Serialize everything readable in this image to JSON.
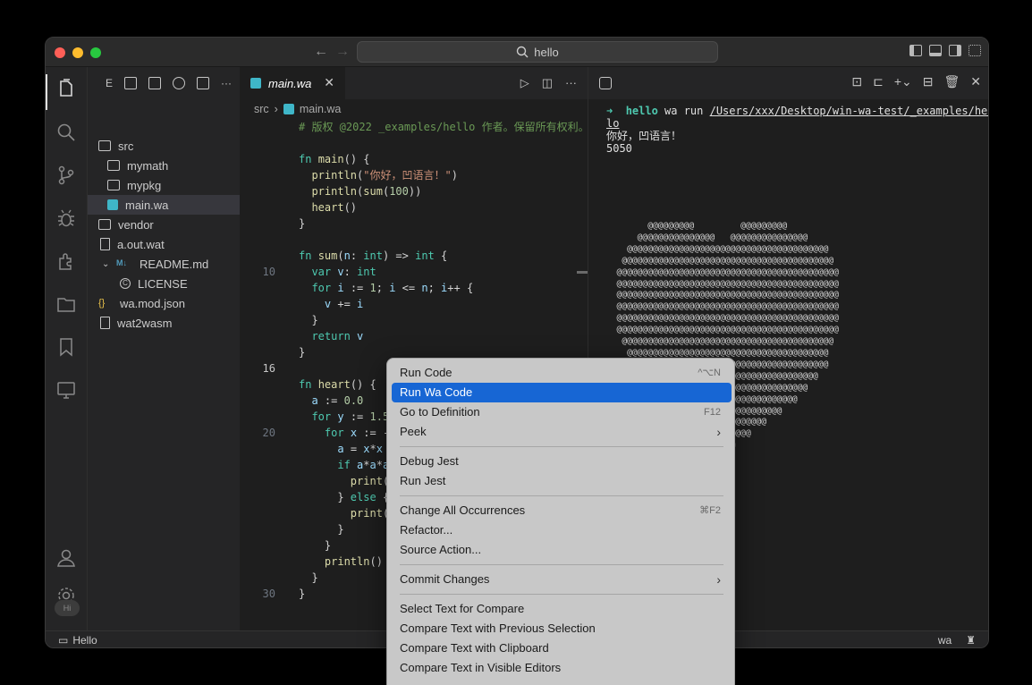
{
  "search": {
    "text": "hello"
  },
  "sidebar": {
    "header_label": "E",
    "items": [
      {
        "label": "src",
        "kind": "folder-open"
      },
      {
        "label": "mymath",
        "kind": "folder"
      },
      {
        "label": "mypkg",
        "kind": "folder"
      },
      {
        "label": "main.wa",
        "kind": "wa"
      },
      {
        "label": "vendor",
        "kind": "folder"
      },
      {
        "label": "a.out.wat",
        "kind": "file"
      },
      {
        "label": "README.md",
        "kind": "md"
      },
      {
        "label": "LICENSE",
        "kind": "license"
      },
      {
        "label": "wa.mod.json",
        "kind": "json"
      },
      {
        "label": "wat2wasm",
        "kind": "file"
      }
    ]
  },
  "editor": {
    "tab_label": "main.wa",
    "breadcrumb": {
      "folder": "src",
      "file": "main.wa"
    },
    "line_numbers": {
      "l10": "10",
      "l16": "16",
      "l20": "20",
      "l30": "30"
    },
    "lines": [
      "# 版权 @2022 _examples/hello 作者。保留所有权利。",
      "",
      "fn main() {",
      "  println(\"你好，凹语言！\")",
      "  println(sum(100))",
      "  heart()",
      "}",
      "",
      "fn sum(n: int) => int {",
      "  var v: int",
      "  for i := 1; i <= n; i++ {",
      "    v += i",
      "  }",
      "  return v",
      "}",
      "",
      "fn heart() {",
      "  a := 0.0",
      "  for y := 1.5",
      "    for x := -",
      "      a = x*x",
      "      if a*a*a",
      "        print(",
      "      } else {",
      "        print(",
      "      }",
      "    }",
      "    println()",
      "  }",
      "}"
    ]
  },
  "terminal": {
    "prompt_cmd": "hello",
    "prompt_rest": " wa run ",
    "path": "/Users/xxx/Desktop/win-wa-test/_examples/hel",
    "path_wrap": "lo",
    "output": [
      "你好，凹语言！",
      "5050"
    ],
    "heart": [
      "        @@@@@@@@@         @@@@@@@@@",
      "      @@@@@@@@@@@@@@@   @@@@@@@@@@@@@@@",
      "    @@@@@@@@@@@@@@@@@@@@@@@@@@@@@@@@@@@@@@@",
      "   @@@@@@@@@@@@@@@@@@@@@@@@@@@@@@@@@@@@@@@@@",
      "  @@@@@@@@@@@@@@@@@@@@@@@@@@@@@@@@@@@@@@@@@@@",
      "  @@@@@@@@@@@@@@@@@@@@@@@@@@@@@@@@@@@@@@@@@@@",
      "  @@@@@@@@@@@@@@@@@@@@@@@@@@@@@@@@@@@@@@@@@@@",
      "  @@@@@@@@@@@@@@@@@@@@@@@@@@@@@@@@@@@@@@@@@@@",
      "  @@@@@@@@@@@@@@@@@@@@@@@@@@@@@@@@@@@@@@@@@@@",
      "  @@@@@@@@@@@@@@@@@@@@@@@@@@@@@@@@@@@@@@@@@@@",
      "   @@@@@@@@@@@@@@@@@@@@@@@@@@@@@@@@@@@@@@@@@",
      "    @@@@@@@@@@@@@@@@@@@@@@@@@@@@@@@@@@@@@@@",
      "    @@@@@@@@@@@@@@@@@@@@@@@@@@@@@@@@@@@@@@@",
      "      @@@@@@@@@@@@@@@@@@@@@@@@@@@@@@@@@@@",
      "        @@@@@@@@@@@@@@@@@@@@@@@@@@@@@@@",
      "          @@@@@@@@@@@@@@@@@@@@@@@@@@@",
      "             @@@@@@@@@@@@@@@@@@@@@",
      "                @@@@@@@@@@@@@@@",
      "                   @@@@@@@@@",
      "                      @@@"
    ]
  },
  "statusbar": {
    "branch": "Hello",
    "language": "wa"
  },
  "context_menu": [
    {
      "label": "Run Code",
      "shortcut": "^⌥N"
    },
    {
      "label": "Run Wa Code",
      "highlight": true
    },
    {
      "label": "Go to Definition",
      "shortcut": "F12"
    },
    {
      "label": "Peek",
      "submenu": true
    },
    {
      "sep": true
    },
    {
      "label": "Debug Jest"
    },
    {
      "label": "Run Jest"
    },
    {
      "sep": true
    },
    {
      "label": "Change All Occurrences",
      "shortcut": "⌘F2"
    },
    {
      "label": "Refactor..."
    },
    {
      "label": "Source Action..."
    },
    {
      "sep": true
    },
    {
      "label": "Commit Changes",
      "submenu": true
    },
    {
      "sep": true
    },
    {
      "label": "Select Text for Compare"
    },
    {
      "label": "Compare Text with Previous Selection"
    },
    {
      "label": "Compare Text with Clipboard"
    },
    {
      "label": "Compare Text in Visible Editors"
    }
  ],
  "activity_icons": [
    "explorer-icon",
    "search-icon",
    "source-control-icon",
    "debug-icon",
    "extensions-icon",
    "folder-icon",
    "bookmark-icon",
    "remote-explorer-icon",
    "account-icon",
    "settings-icon"
  ]
}
